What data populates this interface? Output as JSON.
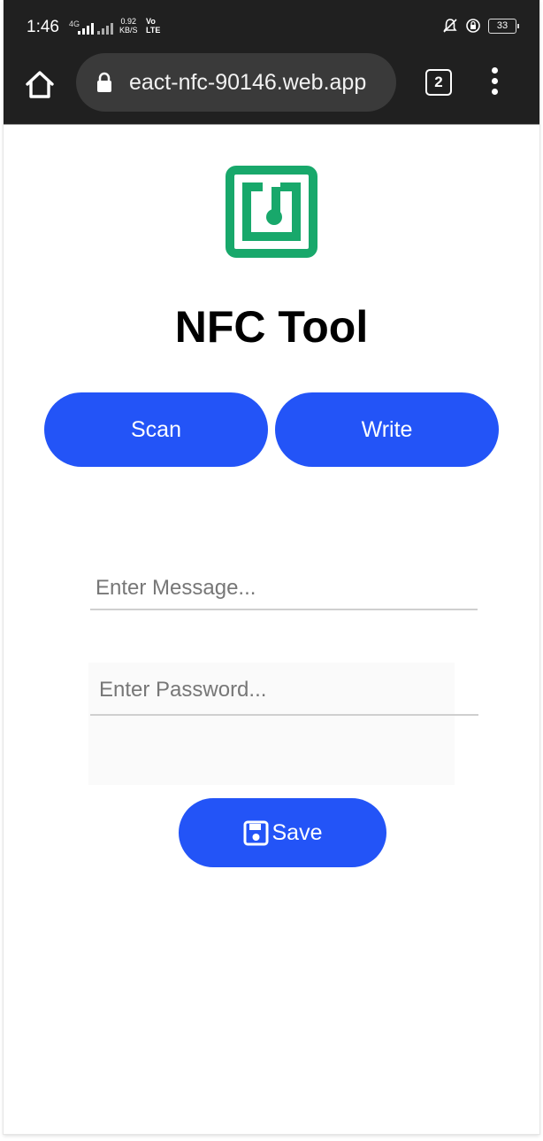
{
  "status_bar": {
    "time": "1:46",
    "network_type": "4G",
    "speed_value": "0.92",
    "speed_unit": "KB/S",
    "volte_top": "Vo",
    "volte_bottom": "LTE",
    "battery": "33"
  },
  "browser": {
    "url": "eact-nfc-90146.web.app",
    "tab_count": "2"
  },
  "app": {
    "title": "NFC Tool",
    "logo_color": "#18a86b",
    "accent_color": "#2354f7",
    "scan_label": "Scan",
    "write_label": "Write",
    "message_placeholder": "Enter Message...",
    "password_placeholder": "Enter Password...",
    "save_label": "Save"
  },
  "icons": [
    "home-icon",
    "lock-icon",
    "tab-switcher-icon",
    "overflow-menu-icon",
    "nfc-logo-icon",
    "save-floppy-icon",
    "mute-bell-icon",
    "data-saver-icon",
    "battery-icon"
  ]
}
